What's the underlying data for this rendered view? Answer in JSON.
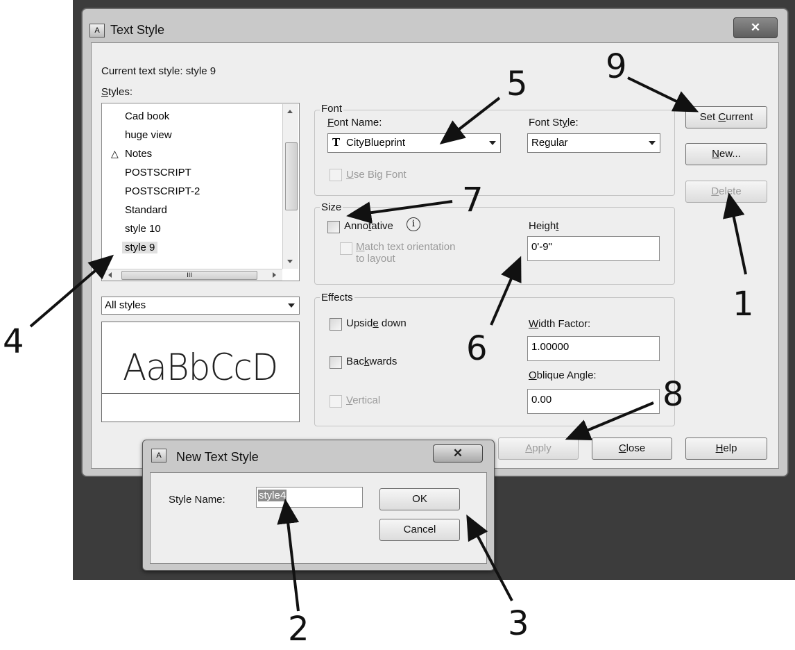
{
  "dialog": {
    "title": "Text Style",
    "close_glyph": "✕",
    "current_style_label": "Current text style:  style 9",
    "styles_label": "Styles:",
    "styles": [
      "Cad book",
      "huge view",
      "Notes",
      "POSTSCRIPT",
      "POSTSCRIPT-2",
      "Standard",
      "style 10",
      "style 9"
    ],
    "selected_style": "style 9",
    "annotative_style": "Notes",
    "scroll_grip": "III",
    "filter_value": "All styles",
    "preview_text": "AaBbCcD",
    "font_group": {
      "title": "Font",
      "font_name_label": "Font Name:",
      "font_name_value": "CityBlueprint",
      "font_style_label": "Font Style:",
      "font_style_value": "Regular",
      "big_font_label": "Use Big Font"
    },
    "size_group": {
      "title": "Size",
      "annotative_label": "Annotative",
      "info_glyph": "i",
      "match_label_1": "Match text orientation",
      "match_label_2": "to layout",
      "height_label": "Height",
      "height_value": "0'-9\""
    },
    "effects_group": {
      "title": "Effects",
      "upside_down_label": "Upside down",
      "backwards_label": "Backwards",
      "vertical_label": "Vertical",
      "width_factor_label": "Width Factor:",
      "width_factor_value": "1.00000",
      "oblique_label": "Oblique Angle:",
      "oblique_value": "0.00"
    },
    "buttons": {
      "set_current": "Set Current",
      "new": "New...",
      "delete": "Delete",
      "apply": "Apply",
      "close": "Close",
      "help": "Help"
    }
  },
  "new_dialog": {
    "title": "New Text Style",
    "close_glyph": "✕",
    "style_name_label": "Style Name:",
    "style_name_value": "style4",
    "ok": "OK",
    "cancel": "Cancel"
  },
  "callouts": [
    "1",
    "2",
    "3",
    "4",
    "5",
    "6",
    "7",
    "8",
    "9"
  ],
  "colors": {
    "window_frame": "#c9c9c9",
    "client": "#eeeeee",
    "background": "#3c3c3c"
  },
  "icons": [
    "text-style-icon",
    "close-icon",
    "truetype-icon",
    "annotative-icon",
    "info-icon",
    "chevron-down-icon"
  ]
}
